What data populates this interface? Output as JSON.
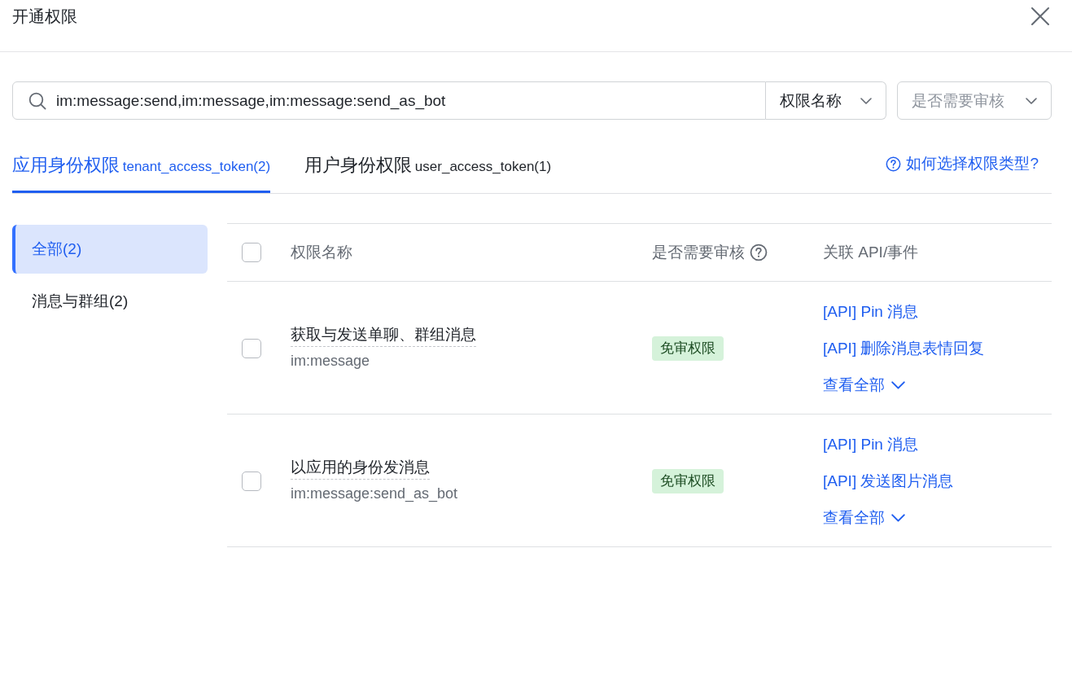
{
  "dialog": {
    "title": "开通权限"
  },
  "search": {
    "value": "im:message:send,im:message,im:message:send_as_bot",
    "field_select": "权限名称",
    "filter_select": {
      "placeholder": "是否需要审核"
    }
  },
  "tabs": [
    {
      "label": "应用身份权限",
      "token": "tenant_access_token(2)",
      "selected": true
    },
    {
      "label": "用户身份权限",
      "token": "user_access_token(1)",
      "selected": false
    }
  ],
  "help_link": "如何选择权限类型?",
  "categories": [
    {
      "label": "全部(2)",
      "selected": true
    },
    {
      "label": "消息与群组(2)",
      "selected": false
    }
  ],
  "table": {
    "header_checked": false,
    "columns": [
      {
        "label": "权限名称",
        "help": false
      },
      {
        "label": "是否需要审核",
        "help": true
      },
      {
        "label": "关联 API/事件",
        "help": false
      }
    ],
    "rows": [
      {
        "checked": false,
        "name": "获取与发送单聊、群组消息",
        "scope": "im:message",
        "approval": "免审权限",
        "apis": [
          "[API] Pin 消息",
          "[API] 删除消息表情回复"
        ],
        "more": "查看全部"
      },
      {
        "checked": false,
        "name": "以应用的身份发消息",
        "scope": "im:message:send_as_bot",
        "approval": "免审权限",
        "apis": [
          "[API] Pin 消息",
          "[API] 发送图片消息"
        ],
        "more": "查看全部"
      }
    ]
  }
}
